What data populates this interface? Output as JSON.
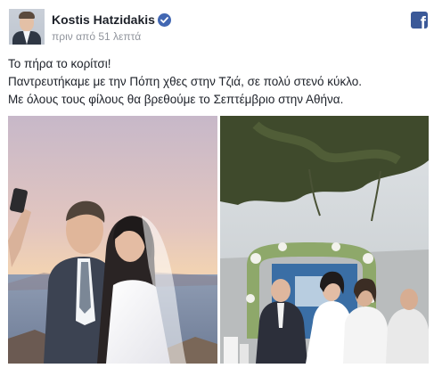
{
  "post": {
    "author": "Kostis Hatzidakis",
    "verified_icon": "verified-badge-icon",
    "timestamp": "πριν από 51 λεπτά",
    "logo_icon": "facebook-logo-icon",
    "lines": [
      "Το πήρα το κορίτσι!",
      "Παντρευτήκαμε με την Πόπη χθες στην Τζιά, σε πολύ στενό κύκλο.",
      "Με όλους τους φίλους θα βρεθούμε το Σεπτέμβριο στην Αθήνα."
    ]
  },
  "colors": {
    "text": "#1d2129",
    "meta": "#90949c",
    "facebook_blue": "#3b5998",
    "verified_blue": "#4267b2"
  }
}
